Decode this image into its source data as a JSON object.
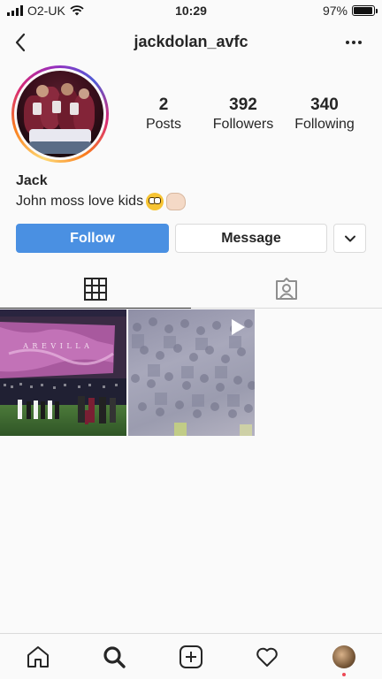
{
  "status_bar": {
    "carrier": "O2-UK",
    "time": "10:29",
    "battery_percent": "97%",
    "battery_level": 0.97
  },
  "header": {
    "username": "jackdolan_avfc"
  },
  "profile": {
    "stats": [
      {
        "count": "2",
        "label": "Posts"
      },
      {
        "count": "392",
        "label": "Followers"
      },
      {
        "count": "340",
        "label": "Following"
      }
    ],
    "name": "Jack",
    "bio": "John moss love kids"
  },
  "actions": {
    "follow_label": "Follow",
    "message_label": "Message"
  },
  "posts": [
    {
      "overlay_text": "A R E   V I L L A"
    },
    {
      "type": "video"
    }
  ],
  "colors": {
    "follow_button": "#4a90e2",
    "notification_dot": "#ed4956"
  },
  "icons": {
    "tabs": [
      "grid-icon",
      "tagged-icon"
    ],
    "tabbar": [
      "home-icon",
      "search-icon",
      "add-post-icon",
      "heart-icon",
      "profile-avatar"
    ]
  }
}
